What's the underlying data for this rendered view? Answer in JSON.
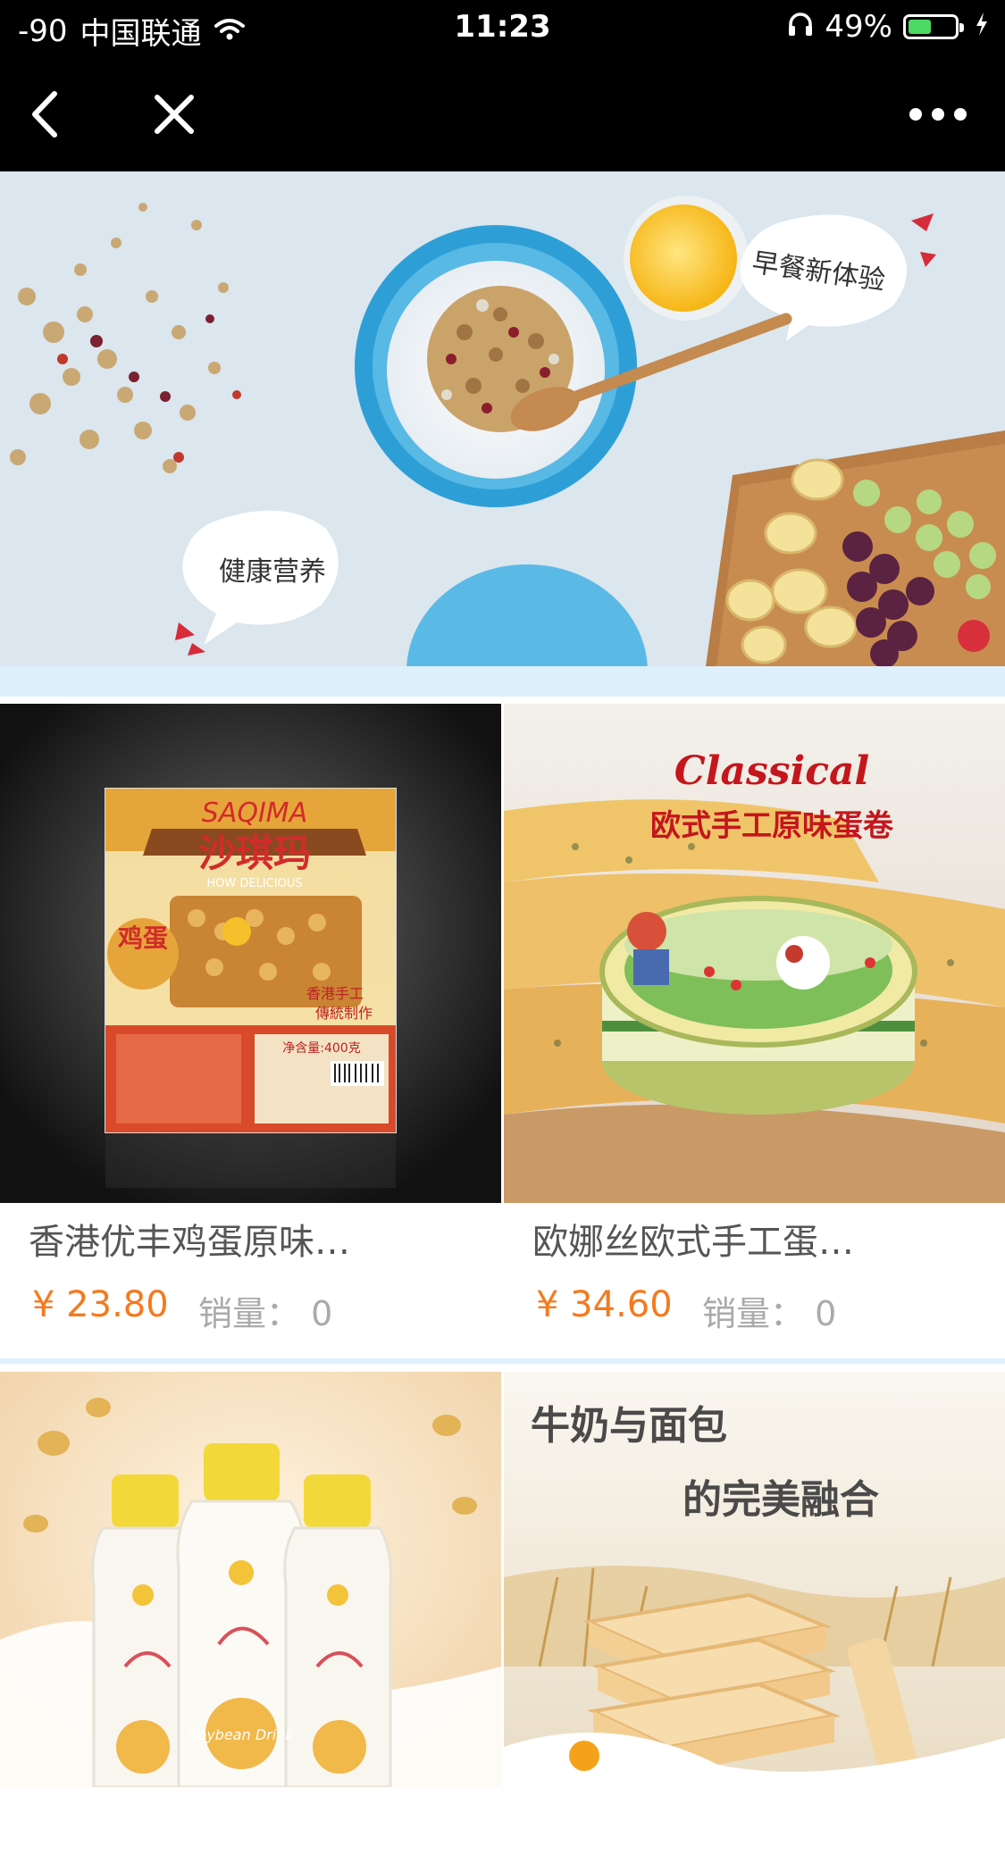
{
  "status_bar": {
    "signal": "-90",
    "carrier": "中国联通",
    "time": "11:23",
    "battery_percent": "49%",
    "battery_level": 0.49
  },
  "banner": {
    "bubble_top": "早餐新体验",
    "bubble_bottom": "健康营养"
  },
  "products": [
    {
      "name": "香港优丰鸡蛋原味…",
      "price": "¥ 23.80",
      "sales": "销量： 0",
      "image": {
        "brand": "SAQIMA",
        "title": "沙琪玛",
        "sub": "HOW DELICIOUS",
        "side": "鸡蛋",
        "tag1": "香港手工",
        "tag2": "傳統制作",
        "net": "净含量:400克"
      }
    },
    {
      "name": "欧娜丝欧式手工蛋…",
      "price": "¥ 34.60",
      "sales": "销量： 0",
      "image": {
        "script": "Classical",
        "title": "欧式手工原味蛋卷"
      }
    },
    {
      "name": "",
      "price": "",
      "sales": "",
      "image": {
        "label": "Soybean Drink"
      }
    },
    {
      "name": "",
      "price": "",
      "sales": "",
      "image": {
        "line1": "牛奶与面包",
        "line2": "的完美融合"
      }
    }
  ],
  "colors": {
    "price": "#f47a1f",
    "divider": "#dff0fd",
    "bar": "#000000"
  }
}
